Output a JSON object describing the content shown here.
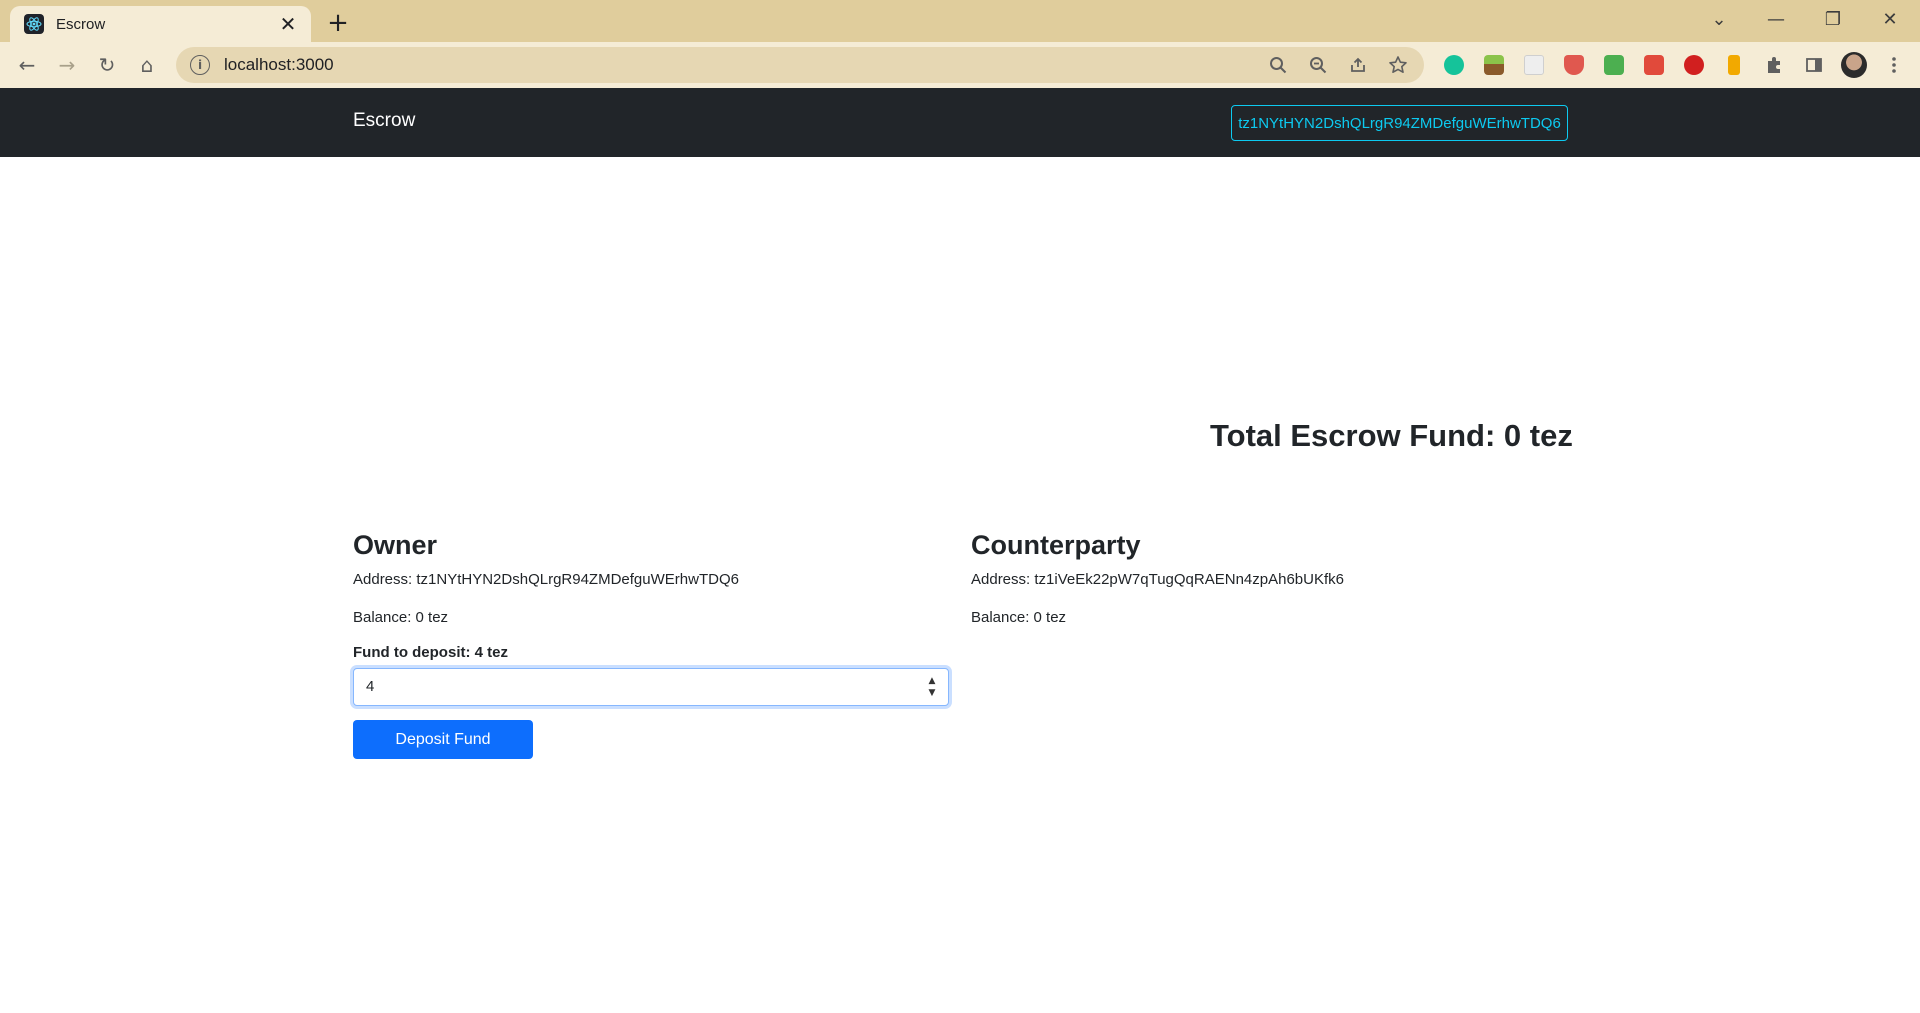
{
  "browser": {
    "tab_title": "Escrow",
    "tab_close_glyph": "✕",
    "new_tab_glyph": "+",
    "url": "localhost:3000",
    "window_controls": {
      "tab_search": "⌄",
      "minimize": "—",
      "restore": "❐",
      "close": "✕"
    },
    "nav": {
      "back": "←",
      "forward": "→",
      "reload": "↻",
      "home": "⌂"
    },
    "omnibox_icons": [
      "search-icon",
      "zoom-out-icon",
      "share-icon",
      "star-icon"
    ],
    "extensions": [
      {
        "name": "grammarly-icon",
        "color": "#15c39a"
      },
      {
        "name": "extension-plant-icon",
        "color": "#8a5a2b"
      },
      {
        "name": "extension-doc-icon",
        "color": "#d8d8d8"
      },
      {
        "name": "extension-shield-icon",
        "color": "#e0584f"
      },
      {
        "name": "extension-check-icon",
        "color": "#4caf50"
      },
      {
        "name": "extension-megaphone-icon",
        "color": "#e14a3b"
      },
      {
        "name": "extension-red-icon",
        "color": "#d11f1f"
      },
      {
        "name": "extension-hammer-icon",
        "color": "#f2a900"
      },
      {
        "name": "extensions-puzzle-icon",
        "color": "#5f5f5f"
      },
      {
        "name": "side-panel-icon",
        "color": "#5f5f5f"
      }
    ]
  },
  "navbar": {
    "brand": "Escrow",
    "wallet_address": "tz1NYtHYN2DshQLrgR94ZMDefguWErhwTDQ6"
  },
  "main": {
    "total_fund": "Total Escrow Fund: 0 tez",
    "owner": {
      "title": "Owner",
      "address": "Address: tz1NYtHYN2DshQLrgR94ZMDefguWErhwTDQ6",
      "balance": "Balance: 0 tez",
      "deposit_label": "Fund to deposit: 4 tez",
      "deposit_value": "4",
      "deposit_button": "Deposit Fund"
    },
    "counterparty": {
      "title": "Counterparty",
      "address": "Address: tz1iVeEk22pW7qTugQqRAENn4zpAh6bUKfk6",
      "balance": "Balance: 0 tez"
    }
  },
  "colors": {
    "chrome_bg": "#e0cd9c",
    "navbar_bg": "#212529",
    "accent_info": "#0dcaf0",
    "primary": "#0d6efd"
  }
}
